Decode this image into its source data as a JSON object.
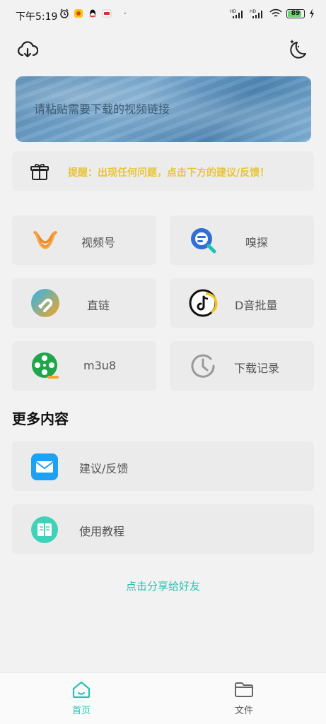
{
  "status_bar": {
    "time": "下午5:19",
    "dot": "·",
    "battery": "89"
  },
  "banner": {
    "placeholder": "请粘贴需要下载的视频链接"
  },
  "notice": {
    "text": "提醒：出现任何问题，点击下方的建议/反馈！",
    "color": "#e8c43a"
  },
  "tiles": [
    {
      "label": "视频号",
      "icon": "wechat-channels-icon"
    },
    {
      "label": "嗅探",
      "icon": "sniff-search-icon"
    },
    {
      "label": "直链",
      "icon": "magnet-link-icon"
    },
    {
      "label": "D音批量",
      "icon": "douyin-music-icon"
    },
    {
      "label": "m3u8",
      "icon": "film-reel-icon"
    },
    {
      "label": "下载记录",
      "icon": "history-clock-icon"
    }
  ],
  "more": {
    "title": "更多内容",
    "items": [
      {
        "label": "建议/反馈",
        "icon": "mail-icon"
      },
      {
        "label": "使用教程",
        "icon": "book-icon"
      }
    ]
  },
  "share": {
    "text": "点击分享给好友",
    "color": "#2bc2b3"
  },
  "bottom_nav": {
    "items": [
      {
        "label": "首页",
        "icon": "home-icon",
        "active": true
      },
      {
        "label": "文件",
        "icon": "folder-icon",
        "active": false
      }
    ]
  }
}
